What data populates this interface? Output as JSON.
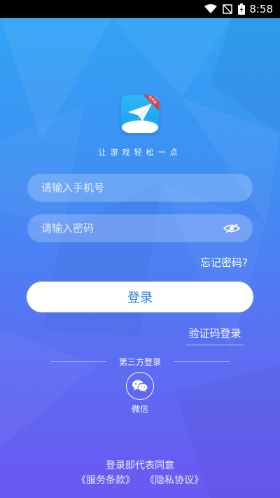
{
  "status_bar": {
    "time": "8:58"
  },
  "app": {
    "badge": "免费版",
    "slogan": "让游戏轻松一点"
  },
  "form": {
    "phone_placeholder": "请输入手机号",
    "password_placeholder": "请输入密码",
    "forgot_label": "忘记密码?",
    "login_label": "登录",
    "sms_login_label": "验证码登录"
  },
  "third_party": {
    "title": "第三方登录",
    "wechat_label": "微信"
  },
  "footer": {
    "agree_text": "登录即代表同意",
    "terms_label": "《服务条款》",
    "privacy_label": "《隐私协议》"
  },
  "colors": {
    "accent": "#2e7fe0",
    "bg_top": "#2fa6f5",
    "bg_bottom": "#6a58f2"
  }
}
